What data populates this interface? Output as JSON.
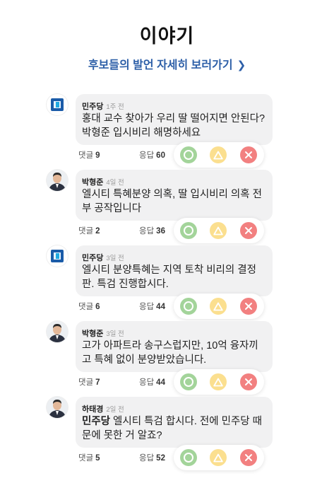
{
  "header": {
    "title": "이야기",
    "link_label": "후보들의 발언 자세히 보러가기",
    "link_chevron": "❯"
  },
  "labels": {
    "replies": "댓글",
    "answers": "응답"
  },
  "posts": [
    {
      "name": "민주당",
      "time": "1주 전",
      "avatar": "party-logo",
      "text_bold": "",
      "text": "홍대 교수 찾아가 우리 딸 떨어지면 안된다? 박형준 입시비리 해명하세요",
      "replies": "9",
      "answers": "60"
    },
    {
      "name": "박형준",
      "time": "4일 전",
      "avatar": "person",
      "text_bold": "",
      "text": "엘시티 특혜분양 의혹, 딸 입시비리 의혹 전부 공작입니다",
      "replies": "2",
      "answers": "36"
    },
    {
      "name": "민주당",
      "time": "3일 전",
      "avatar": "party-logo",
      "text_bold": "",
      "text": "엘시티 분양특혜는 지역 토착 비리의 결정판. 특검 진행합시다.",
      "replies": "6",
      "answers": "44"
    },
    {
      "name": "박형준",
      "time": "3일 전",
      "avatar": "person",
      "text_bold": "",
      "text": "고가 아파트라 송구스럽지만, 10억 융자끼고 특혜 없이 분양받았습니다.",
      "replies": "7",
      "answers": "44"
    },
    {
      "name": "하태경",
      "time": "2일 전",
      "avatar": "person",
      "text_bold": "민주당",
      "text": " 엘시티 특검 합시다. 전에 민주당 때문에 못한 거 알죠?",
      "replies": "5",
      "answers": "52"
    }
  ],
  "colors": {
    "link": "#2d5fa8",
    "agree": "#a3d49a",
    "neutral": "#fbdf8f",
    "disagree": "#f28080",
    "bubble": "#f1f1f2"
  }
}
